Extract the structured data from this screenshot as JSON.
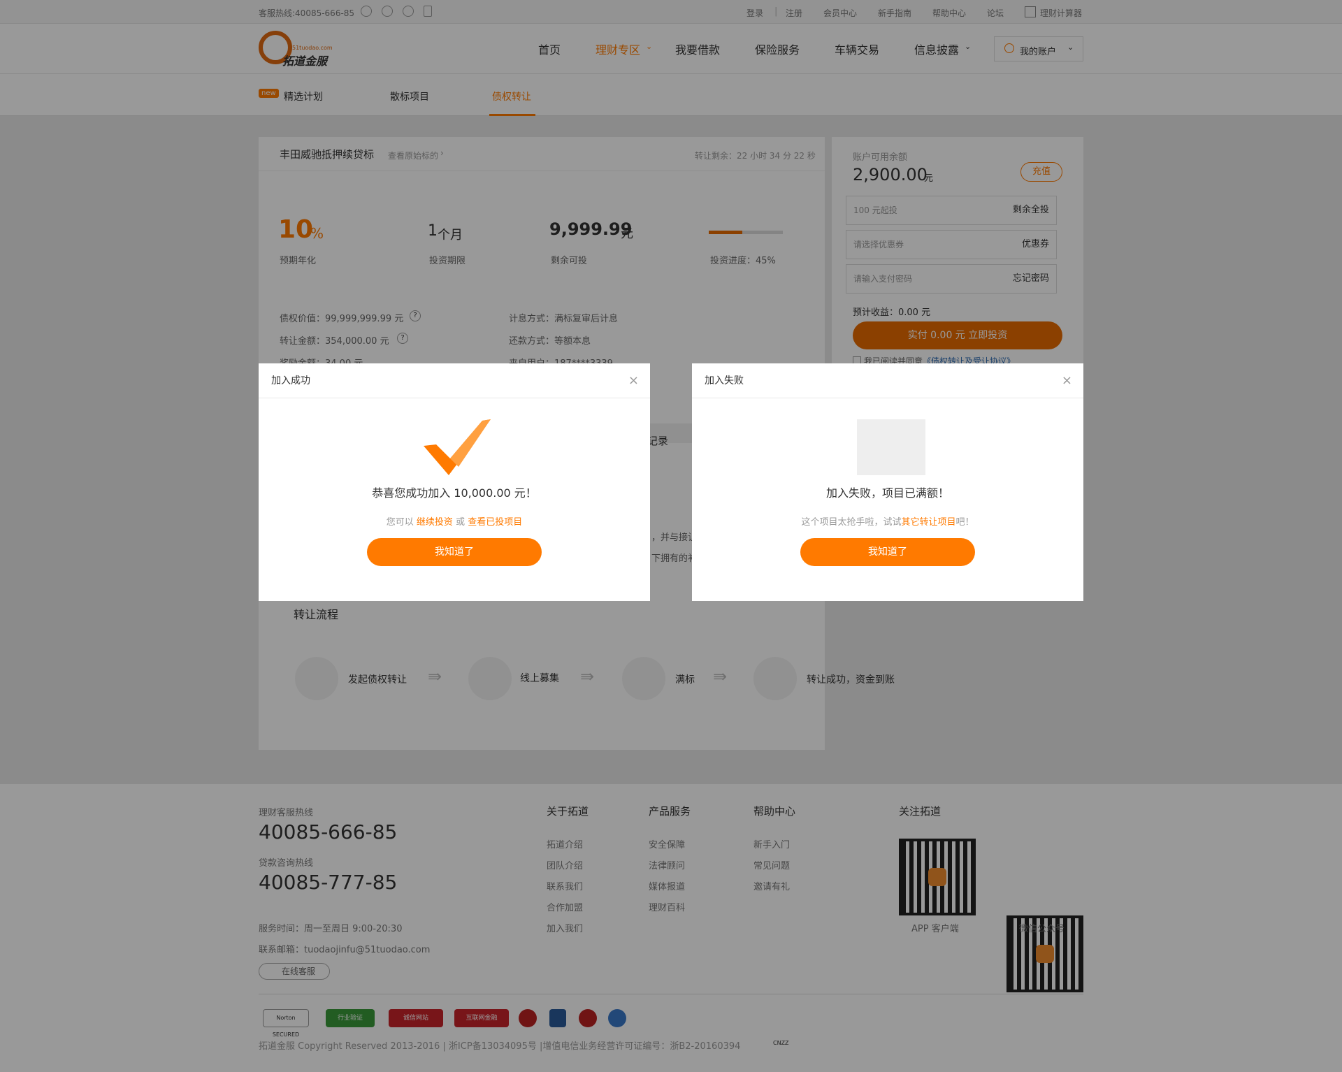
{
  "topbar": {
    "hotline": "客服热线:40085-666-85",
    "links": [
      "登录",
      "注册",
      "会员中心",
      "新手指南",
      "帮助中心",
      "论坛",
      "理财计算器"
    ]
  },
  "header": {
    "logo_text": "拓道金服",
    "logo_domain": "51tuodao.com",
    "nav": [
      "首页",
      "理财专区",
      "我要借款",
      "保险服务",
      "车辆交易",
      "信息披露"
    ],
    "account": "我的账户"
  },
  "subnav": {
    "badge": "new",
    "items": [
      "精选计划",
      "散标项目",
      "债权转让"
    ]
  },
  "detail": {
    "title": "丰田威驰抵押续贷标",
    "view_original": "查看原始标的",
    "countdown": "转让剩余：22 小时 34 分 22 秒",
    "rate_value": "10",
    "rate_unit": "%",
    "rate_label": "预期年化",
    "period_value": "1",
    "period_unit": "个月",
    "period_label": "投资期限",
    "remain_value": "9,999.99",
    "remain_unit": "元",
    "remain_label": "剩余可投",
    "progress_label": "投资进度：45%",
    "progress_fraction": 0.45,
    "info_left": [
      "债权价值：99,999,999.99 元",
      "转让金额：354,000.00 元",
      "奖励金额：34.00 元"
    ],
    "info_right": [
      "计息方式：满标复审后计息",
      "还款方式：等额本息",
      "来自用户：187****3339"
    ],
    "records_tab": "记录",
    "partial_text": [
      "，并与接让",
      "下拥有的补"
    ]
  },
  "process": {
    "title": "转让流程",
    "steps": [
      "发起债权转让",
      "线上募集",
      "满标",
      "转让成功，资金到账"
    ]
  },
  "invest": {
    "balance_label": "账户可用余额",
    "balance_value": "2,900.00",
    "balance_unit": "元",
    "recharge": "充值",
    "amount_placeholder": "100 元起投",
    "amount_action": "剩余全投",
    "coupon_placeholder": "请选择优惠券",
    "coupon_action": "优惠券",
    "password_placeholder": "请输入支付密码",
    "password_action": "忘记密码",
    "expected": "预计收益：0.00 元",
    "submit": "实付 0.00 元  立即投资",
    "agree_prefix": "我已阅读并同意",
    "agree_link": "《债权转让及受让协议》"
  },
  "modal_success": {
    "title": "加入成功",
    "message": "恭喜您成功加入 10,000.00 元！",
    "hint_prefix": "您可以",
    "hint_link1": "继续投资",
    "hint_or": "或",
    "hint_link2": "查看已投项目",
    "button": "我知道了"
  },
  "modal_fail": {
    "title": "加入失败",
    "message": "加入失败，项目已满额！",
    "hint_prefix": "这个项目太抢手啦，试试",
    "hint_link": "其它转让项目",
    "hint_suffix": "吧！",
    "button": "我知道了"
  },
  "footer": {
    "hotline_label": "理财客服热线",
    "hotline": "40085-666-85",
    "loan_label": "贷款咨询热线",
    "loan": "40085-777-85",
    "hours": "服务时间：周一至周日  9:00-20:30",
    "email": "联系邮箱：tuodaojinfu@51tuodao.com",
    "online": "在线客服",
    "columns": [
      {
        "title": "关于拓道",
        "items": [
          "拓道介绍",
          "团队介绍",
          "联系我们",
          "合作加盟",
          "加入我们"
        ]
      },
      {
        "title": "产品服务",
        "items": [
          "安全保障",
          "法律顾问",
          "媒体报道",
          "理财百科"
        ]
      },
      {
        "title": "帮助中心",
        "items": [
          "新手入门",
          "常见问题",
          "邀请有礼"
        ]
      }
    ],
    "follow": "关注拓道",
    "qr1": "APP 客户端",
    "qr2": "微信公众号",
    "badges": [
      "Norton SECURED",
      "行业验证",
      "诚信网站",
      "互联网金融"
    ],
    "copyright": "拓道金服 Copyright Reserved 2013-2016 | 浙ICP备13034095号 |增值电信业务经营许可证编号：浙B2-20160394",
    "cnzz": "CNZZ"
  },
  "colors": {
    "accent": "#ff7a00",
    "overlay": "rgba(0,0,0,0.4)"
  }
}
